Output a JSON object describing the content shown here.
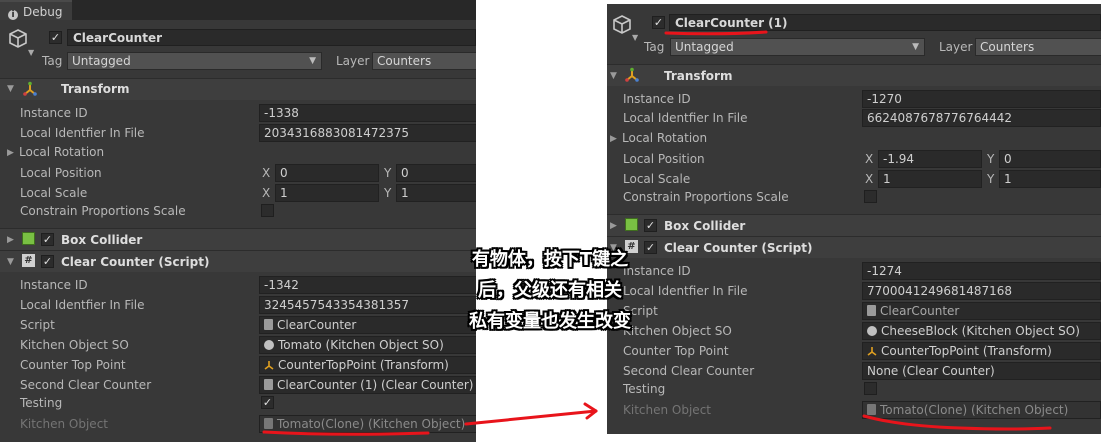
{
  "left": {
    "tab_label": "Debug",
    "object_name": "ClearCounter",
    "tag_label": "Tag",
    "tag_value": "Untagged",
    "layer_label": "Layer",
    "layer_value": "Counters",
    "transform": {
      "title": "Transform",
      "instance_id_label": "Instance ID",
      "instance_id": "-1338",
      "local_id_label": "Local Identfier In File",
      "local_id": "2034316883081472375",
      "rotation_label": "Local Rotation",
      "position_label": "Local Position",
      "pos_x": "0",
      "pos_y": "0",
      "scale_label": "Local Scale",
      "scale_x": "1",
      "scale_y": "1",
      "constrain_label": "Constrain Proportions Scale",
      "x": "X",
      "y": "Y"
    },
    "box_collider": "Box Collider",
    "script": {
      "title": "Clear Counter (Script)",
      "instance_id_label": "Instance ID",
      "instance_id": "-1342",
      "local_id_label": "Local Identfier In File",
      "local_id": "3245457543354381357",
      "script_label": "Script",
      "script_value": "ClearCounter",
      "kitchen_so_label": "Kitchen Object SO",
      "kitchen_so_value": "Tomato (Kitchen Object SO)",
      "counter_top_label": "Counter Top Point",
      "counter_top_value": "CounterTopPoint (Transform)",
      "second_label": "Second Clear Counter",
      "second_value": "ClearCounter (1) (Clear Counter)",
      "testing_label": "Testing",
      "testing_checked": true,
      "kitchen_obj_label": "Kitchen Object",
      "kitchen_obj_value": "Tomato(Clone) (Kitchen Object)"
    }
  },
  "right": {
    "object_name": "ClearCounter (1)",
    "tag_label": "Tag",
    "tag_value": "Untagged",
    "layer_label": "Layer",
    "layer_value": "Counters",
    "transform": {
      "title": "Transform",
      "instance_id_label": "Instance ID",
      "instance_id": "-1270",
      "local_id_label": "Local Identfier In File",
      "local_id": "6624087678776764442",
      "rotation_label": "Local Rotation",
      "position_label": "Local Position",
      "pos_x": "-1.94",
      "pos_y": "0",
      "scale_label": "Local Scale",
      "scale_x": "1",
      "scale_y": "1",
      "constrain_label": "Constrain Proportions Scale",
      "x": "X",
      "y": "Y"
    },
    "box_collider": "Box Collider",
    "script": {
      "title": "Clear Counter (Script)",
      "instance_id_label": "Instance ID",
      "instance_id": "-1274",
      "local_id_label": "Local Identfier In File",
      "local_id": "7700041249681487168",
      "script_label": "Script",
      "script_value": "ClearCounter",
      "kitchen_so_label": "Kitchen Object SO",
      "kitchen_so_value": "CheeseBlock (Kitchen Object SO)",
      "counter_top_label": "Counter Top Point",
      "counter_top_value": "CounterTopPoint (Transform)",
      "second_label": "Second Clear Counter",
      "second_value": "None (Clear Counter)",
      "testing_label": "Testing",
      "testing_checked": false,
      "kitchen_obj_label": "Kitchen Object",
      "kitchen_obj_value": "Tomato(Clone) (Kitchen Object)"
    }
  },
  "annotation": {
    "line1": "有物体，按下T键之",
    "line2": "后，父级还有相关",
    "line3": "私有变量也发生改变"
  },
  "colors": {
    "panel_bg": "#383838",
    "field_bg": "#2a2a2a",
    "annotation_red": "#e8141b",
    "transform_icon": "#e0a020"
  }
}
